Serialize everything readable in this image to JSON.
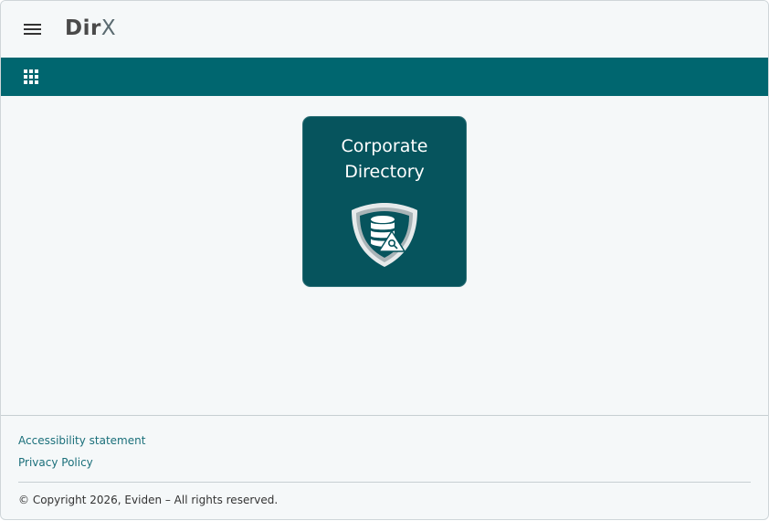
{
  "header": {
    "menu_icon": "hamburger-menu-icon",
    "logo_main": "Dir",
    "logo_x": "X"
  },
  "toolbar": {
    "apps_icon": "apps-grid-icon",
    "background_color": "#00666f"
  },
  "tiles": [
    {
      "label": "Corporate\nDirectory",
      "icon": "shield-database-icon",
      "background_color": "#06545d"
    }
  ],
  "footer": {
    "links": [
      "Accessibility statement",
      "Privacy Policy"
    ],
    "copyright": "© Copyright 2026, Eviden – All rights reserved."
  }
}
